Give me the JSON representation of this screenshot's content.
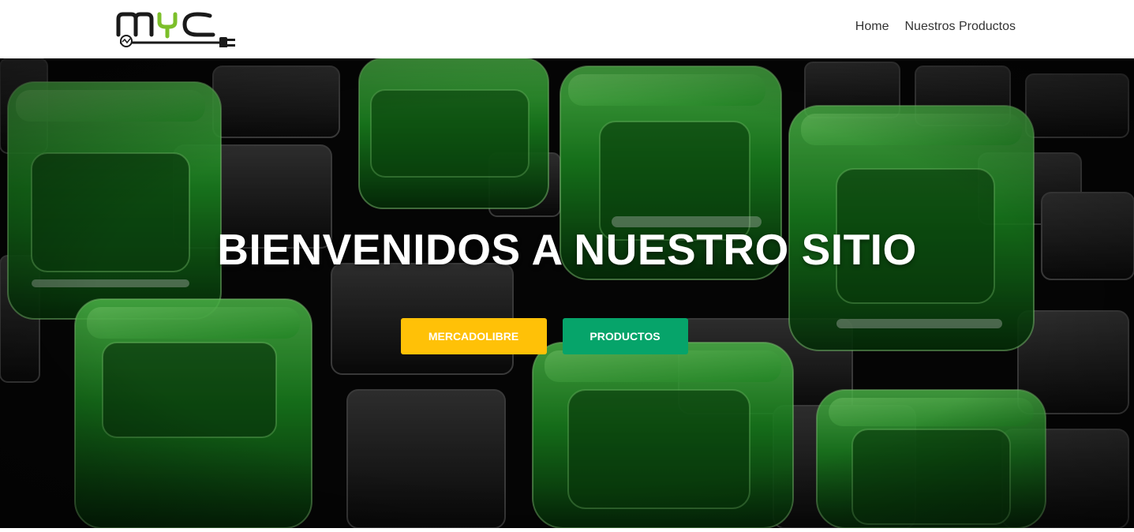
{
  "header": {
    "logo_text": "MYC",
    "nav": [
      {
        "label": "Home"
      },
      {
        "label": "Nuestros Productos"
      }
    ]
  },
  "hero": {
    "title": "BIENVENIDOS A NUESTRO SITIO",
    "buttons": {
      "mercadolibre": "MERCADOLIBRE",
      "productos": "PRODUCTOS"
    }
  },
  "colors": {
    "mercadolibre_button": "#ffc107",
    "productos_button": "#06a46a",
    "logo_green": "#7cbf2a",
    "hero_glow": "#1fbf2a"
  }
}
